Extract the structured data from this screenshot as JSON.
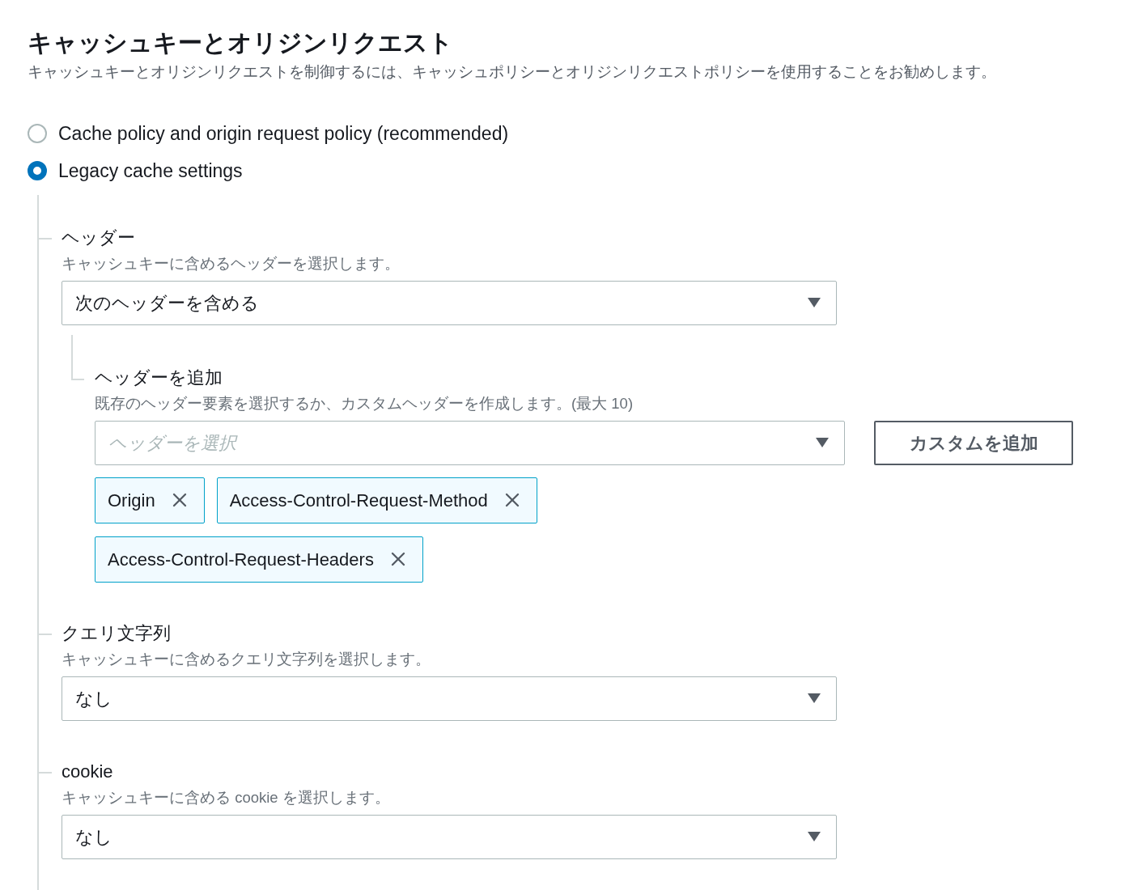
{
  "title": "キャッシュキーとオリジンリクエスト",
  "description": "キャッシュキーとオリジンリクエストを制御するには、キャッシュポリシーとオリジンリクエストポリシーを使用することをお勧めします。",
  "options": [
    {
      "label": "Cache policy and origin request policy (recommended)",
      "selected": false
    },
    {
      "label": "Legacy cache settings",
      "selected": true
    }
  ],
  "sections": [
    {
      "label": "ヘッダー",
      "description": "キャッシュキーに含めるヘッダーを選択します。",
      "select": {
        "value": "次のヘッダーを含める"
      },
      "add_header": {
        "label": "ヘッダーを追加",
        "description": "既存のヘッダー要素を選択するか、カスタムヘッダーを作成します。(最大 10)",
        "select": {
          "placeholder": "ヘッダーを選択"
        },
        "button": "カスタムを追加",
        "tokens": [
          {
            "label": "Origin"
          },
          {
            "label": "Access-Control-Request-Method"
          },
          {
            "label": "Access-Control-Request-Headers"
          }
        ]
      }
    },
    {
      "label": "クエリ文字列",
      "description": "キャッシュキーに含めるクエリ文字列を選択します。",
      "select": {
        "value": "なし"
      }
    },
    {
      "label": "cookie",
      "description": "キャッシュキーに含める cookie を選択します。",
      "select": {
        "value": "なし"
      }
    }
  ]
}
